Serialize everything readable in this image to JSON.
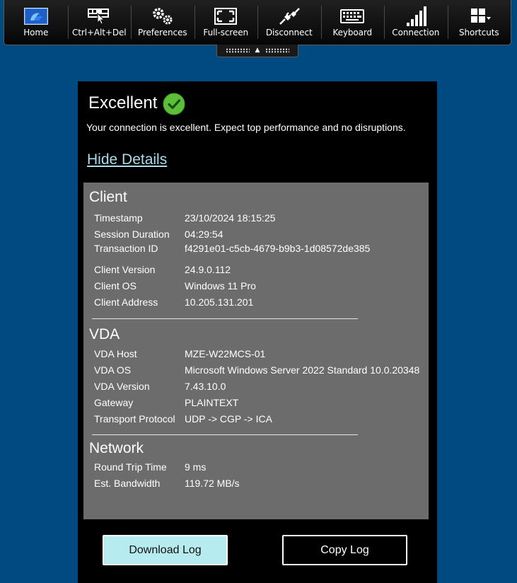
{
  "toolbar": {
    "items": [
      {
        "label": "Home",
        "icon": "home-icon"
      },
      {
        "label": "Ctrl+Alt+Del",
        "icon": "ctrl-alt-del-icon"
      },
      {
        "label": "Preferences",
        "icon": "gears-icon"
      },
      {
        "label": "Full-screen",
        "icon": "fullscreen-icon"
      },
      {
        "label": "Disconnect",
        "icon": "plug-icon"
      },
      {
        "label": "Keyboard",
        "icon": "keyboard-icon"
      },
      {
        "label": "Connection",
        "icon": "signal-bars-icon"
      },
      {
        "label": "Shortcuts",
        "icon": "grid-icon"
      }
    ]
  },
  "status": {
    "title": "Excellent",
    "description": "Your connection is excellent. Expect top performance and no disruptions.",
    "icon": "check-circle-icon",
    "icon_color": "#5bbf3a"
  },
  "hide_details": "Hide Details",
  "client": {
    "heading": "Client",
    "rows": [
      {
        "key": "Timestamp",
        "value": "23/10/2024 18:15:25"
      },
      {
        "key": "Session Duration",
        "value": "04:29:54"
      },
      {
        "key": "Transaction ID",
        "value": "f4291e01-c5cb-4679-b9b3-1d08572de385"
      },
      {
        "key": "Client Version",
        "value": "24.9.0.112"
      },
      {
        "key": "Client OS",
        "value": "Windows 11 Pro"
      },
      {
        "key": "Client Address",
        "value": "10.205.131.201"
      }
    ]
  },
  "vda": {
    "heading": "VDA",
    "rows": [
      {
        "key": "VDA Host",
        "value": "MZE-W22MCS-01"
      },
      {
        "key": "VDA OS",
        "value": "Microsoft Windows Server 2022 Standard 10.0.20348"
      },
      {
        "key": "VDA Version",
        "value": "7.43.10.0"
      },
      {
        "key": "Gateway",
        "value": "PLAINTEXT"
      },
      {
        "key": "Transport Protocol",
        "value": "UDP -> CGP -> ICA"
      }
    ]
  },
  "network": {
    "heading": "Network",
    "rows": [
      {
        "key": "Round Trip Time",
        "value": "9 ms"
      },
      {
        "key": "Est. Bandwidth",
        "value": "119.72 MB/s"
      }
    ]
  },
  "buttons": {
    "download": "Download Log",
    "copy": "Copy Log"
  },
  "colors": {
    "desktop": "#004a82",
    "details_bg": "#6c6c6c",
    "link": "#a9dcec",
    "download_button": "#b6ecf0"
  }
}
